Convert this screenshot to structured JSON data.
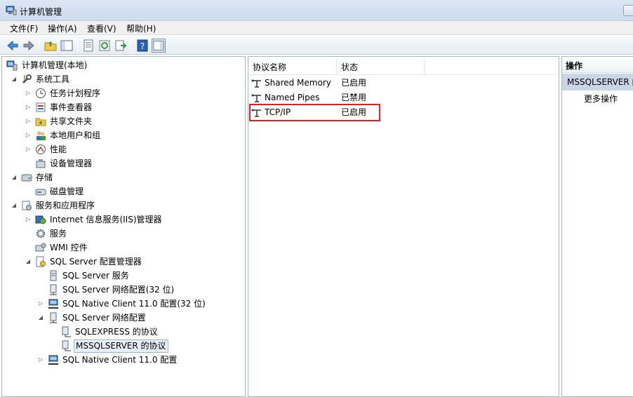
{
  "window": {
    "title": "计算机管理"
  },
  "menu": {
    "file": "文件(F)",
    "action": "操作(A)",
    "view": "查看(V)",
    "help": "帮助(H)"
  },
  "tree": {
    "root": "计算机管理(本地)",
    "system_tools": "系统工具",
    "task_scheduler": "任务计划程序",
    "event_viewer": "事件查看器",
    "shared_folders": "共享文件夹",
    "local_users": "本地用户和组",
    "performance": "性能",
    "device_manager": "设备管理器",
    "storage": "存储",
    "disk_management": "磁盘管理",
    "services_apps": "服务和应用程序",
    "iis_manager": "Internet 信息服务(IIS)管理器",
    "services": "服务",
    "wmi_control": "WMI 控件",
    "sql_config_manager": "SQL Server 配置管理器",
    "sql_services": "SQL Server 服务",
    "sql_net_config_32": "SQL Server 网络配置(32 位)",
    "native_client_32": "SQL Native Client 11.0 配置(32 位)",
    "sql_net_config": "SQL Server 网络配置",
    "sqlexpress_protocols": "SQLEXPRESS 的协议",
    "mssqlserver_protocols": "MSSQLSERVER 的协议",
    "native_client": "SQL Native Client 11.0 配置"
  },
  "list": {
    "columns": [
      "协议名称",
      "状态"
    ],
    "rows": [
      {
        "name": "Shared Memory",
        "status": "已启用"
      },
      {
        "name": "Named Pipes",
        "status": "已禁用"
      },
      {
        "name": "TCP/IP",
        "status": "已启用"
      }
    ]
  },
  "actions": {
    "header": "操作",
    "section": "MSSQLSERVER 的",
    "more": "更多操作"
  },
  "colors": {
    "highlight_border": "#e02020",
    "selection": "#e5eef9"
  }
}
